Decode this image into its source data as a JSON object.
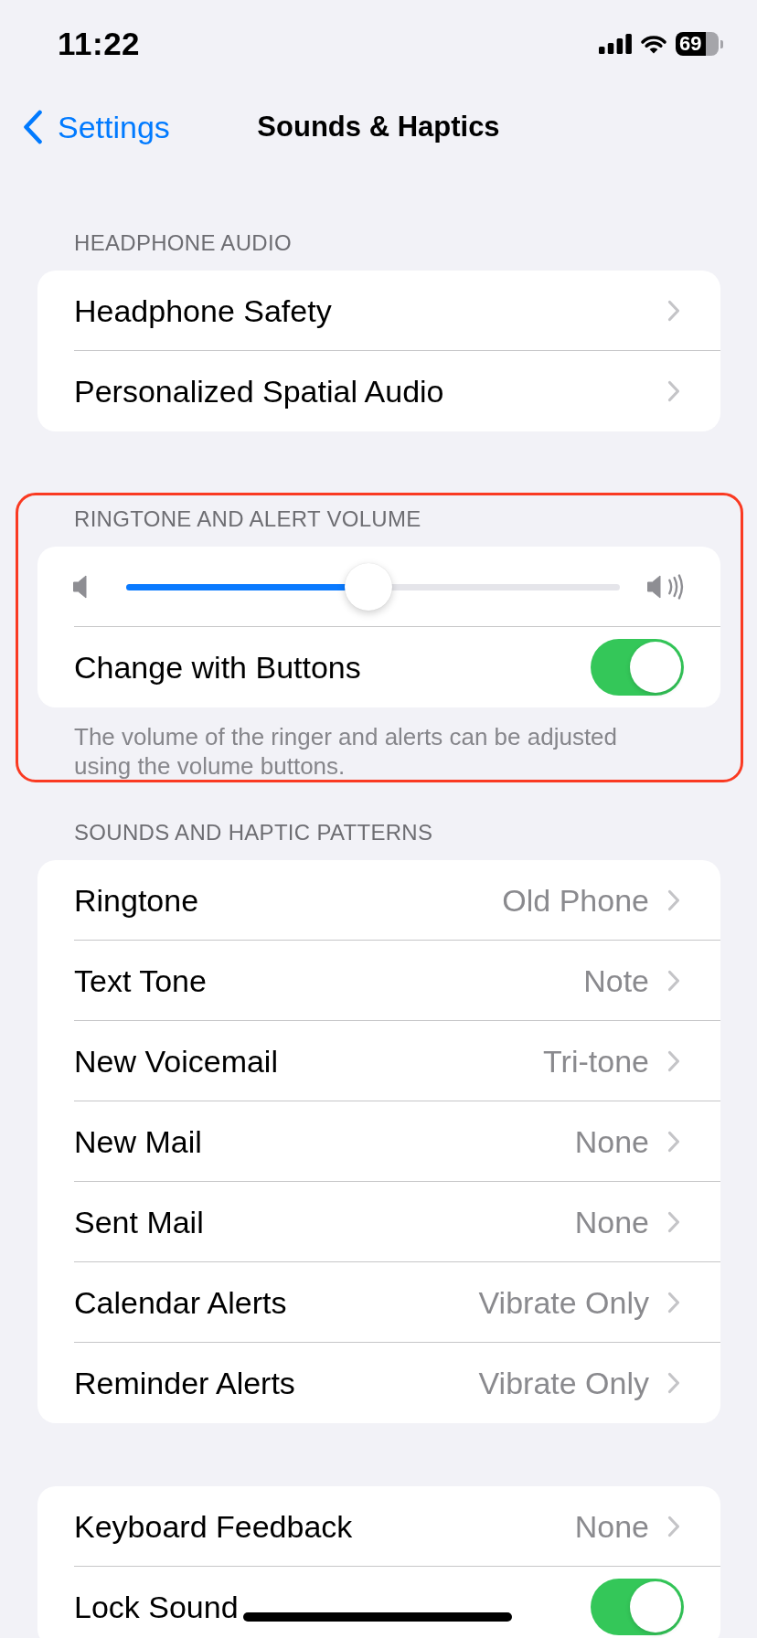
{
  "status_bar": {
    "time": "11:22",
    "battery": "69"
  },
  "nav": {
    "back": "Settings",
    "title": "Sounds & Haptics"
  },
  "sections": [
    {
      "header": "HEADPHONE AUDIO",
      "rows": [
        {
          "kind": "link",
          "label": "Headphone Safety"
        },
        {
          "kind": "link",
          "label": "Personalized Spatial Audio"
        }
      ]
    },
    {
      "header": "RINGTONE AND ALERT VOLUME",
      "highlighted": true,
      "rows": [
        {
          "kind": "slider",
          "level": 0.49
        },
        {
          "kind": "toggle",
          "label": "Change with Buttons",
          "on": true
        }
      ],
      "footer": "The volume of the ringer and alerts can be adjusted using the volume buttons."
    },
    {
      "header": "SOUNDS AND HAPTIC PATTERNS",
      "rows": [
        {
          "kind": "link",
          "label": "Ringtone",
          "value": "Old Phone"
        },
        {
          "kind": "link",
          "label": "Text Tone",
          "value": "Note"
        },
        {
          "kind": "link",
          "label": "New Voicemail",
          "value": "Tri-tone"
        },
        {
          "kind": "link",
          "label": "New Mail",
          "value": "None"
        },
        {
          "kind": "link",
          "label": "Sent Mail",
          "value": "None"
        },
        {
          "kind": "link",
          "label": "Calendar Alerts",
          "value": "Vibrate Only"
        },
        {
          "kind": "link",
          "label": "Reminder Alerts",
          "value": "Vibrate Only"
        }
      ]
    },
    {
      "rows": [
        {
          "kind": "link",
          "label": "Keyboard Feedback",
          "value": "None"
        },
        {
          "kind": "toggle",
          "label": "Lock Sound",
          "on": true
        }
      ]
    }
  ]
}
